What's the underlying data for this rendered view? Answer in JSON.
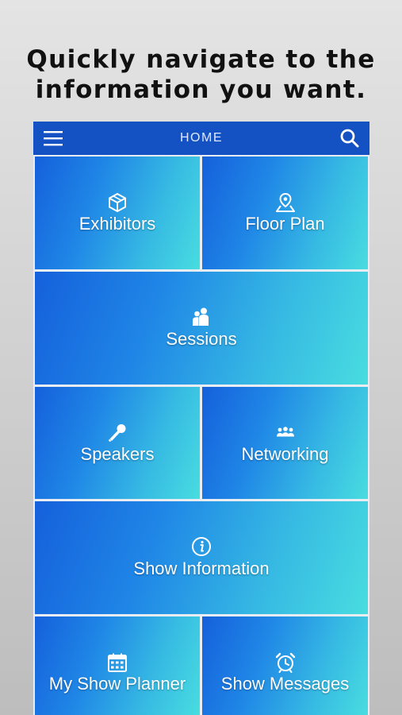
{
  "headline": {
    "line1": "Quickly navigate to the",
    "line2": "information you want."
  },
  "navbar": {
    "title": "HOME",
    "menu_icon": "hamburger-menu-icon",
    "search_icon": "search-icon",
    "background": "#1451c2"
  },
  "tiles": [
    {
      "label": "Exhibitors",
      "icon": "cube-icon"
    },
    {
      "label": "Floor Plan",
      "icon": "map-pin-icon"
    },
    {
      "label": "Sessions",
      "icon": "people-icon"
    },
    {
      "label": "Speakers",
      "icon": "microphone-icon"
    },
    {
      "label": "Networking",
      "icon": "group-icon"
    },
    {
      "label": "Show Information",
      "icon": "info-icon"
    },
    {
      "label": "My Show Planner",
      "icon": "calendar-icon"
    },
    {
      "label": "Show Messages",
      "icon": "alarm-clock-icon"
    }
  ],
  "colors": {
    "tile_gradient_start": "#1560db",
    "tile_gradient_end": "#48dde0",
    "divider": "#e9ecf0"
  }
}
